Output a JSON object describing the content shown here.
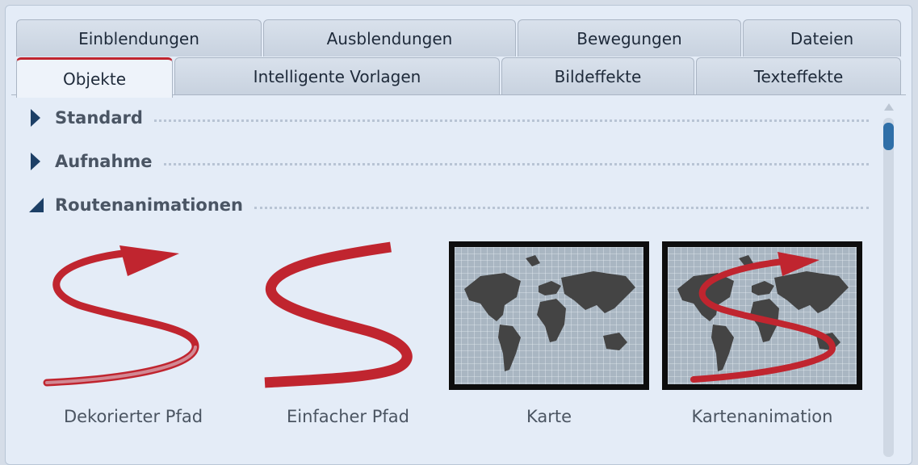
{
  "tabs_row1": [
    {
      "label": "Einblendungen"
    },
    {
      "label": "Ausblendungen"
    },
    {
      "label": "Bewegungen"
    },
    {
      "label": "Dateien"
    }
  ],
  "tabs_row2": [
    {
      "label": "Objekte",
      "active": true
    },
    {
      "label": "Intelligente Vorlagen"
    },
    {
      "label": "Bildeffekte"
    },
    {
      "label": "Texteffekte"
    }
  ],
  "sections": [
    {
      "title": "Standard",
      "expanded": false
    },
    {
      "title": "Aufnahme",
      "expanded": false
    },
    {
      "title": "Routenanimationen",
      "expanded": true
    }
  ],
  "items": [
    {
      "label": "Dekorierter Pfad",
      "icon": "decorated-path-icon"
    },
    {
      "label": "Einfacher Pfad",
      "icon": "simple-path-icon"
    },
    {
      "label": "Karte",
      "icon": "map-icon"
    },
    {
      "label": "Kartenanimation",
      "icon": "map-animation-icon"
    }
  ],
  "colors": {
    "accent_red": "#c0252f",
    "triangle": "#1c3f66",
    "panel_bg": "#e4ecf7",
    "scroll_thumb": "#2f6fa8"
  }
}
